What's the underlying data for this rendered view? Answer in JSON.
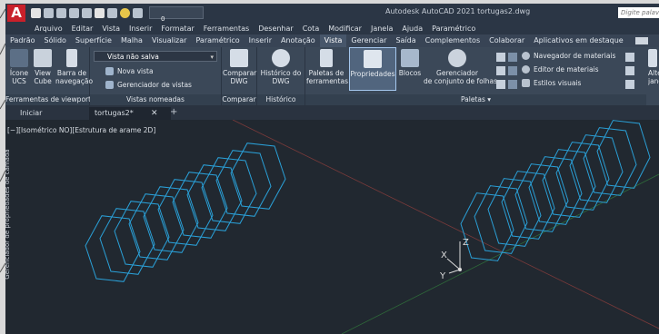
{
  "title_bar": {
    "logo": "A",
    "workspace_value": "0",
    "app_title": "Autodesk AutoCAD 2021   tortugas2.dwg",
    "search_placeholder": "Digite palavra-"
  },
  "menu": [
    "Arquivo",
    "Editar",
    "Vista",
    "Inserir",
    "Formatar",
    "Ferramentas",
    "Desenhar",
    "Cota",
    "Modificar",
    "Janela",
    "Ajuda",
    "Paramétrico"
  ],
  "ribbon_tabs": [
    {
      "label": "Padrão",
      "active": false
    },
    {
      "label": "Sólido",
      "active": false
    },
    {
      "label": "Superfície",
      "active": false
    },
    {
      "label": "Malha",
      "active": false
    },
    {
      "label": "Visualizar",
      "active": false
    },
    {
      "label": "Paramétrico",
      "active": false
    },
    {
      "label": "Inserir",
      "active": false
    },
    {
      "label": "Anotação",
      "active": false
    },
    {
      "label": "Vista",
      "active": true
    },
    {
      "label": "Gerenciar",
      "active": false
    },
    {
      "label": "Saída",
      "active": false
    },
    {
      "label": "Complementos",
      "active": false
    },
    {
      "label": "Colaborar",
      "active": false
    },
    {
      "label": "Aplicativos em destaque",
      "active": false
    }
  ],
  "panels": {
    "viewport_tools": {
      "title": "Ferramentas de viewport",
      "ucs_icon_l1": "Ícone",
      "ucs_icon_l2": "UCS",
      "viewcube_l1": "View",
      "viewcube_l2": "Cube",
      "navbar_l1": "Barra de",
      "navbar_l2": "navegação"
    },
    "named_views": {
      "title": "Vistas nomeadas",
      "view_select": "Vista não salva",
      "new_view": "Nova vista",
      "view_manager": "Gerenciador de vistas"
    },
    "compare": {
      "title": "Comparar",
      "btn_l1": "Comparar",
      "btn_l2": "DWG"
    },
    "history": {
      "title": "Histórico",
      "btn_l1": "Histórico do",
      "btn_l2": "DWG"
    },
    "palettes": {
      "title": "Paletas",
      "tool_palettes_l1": "Paletas de",
      "tool_palettes_l2": "ferramentas",
      "properties": "Propriedades",
      "blocks": "Blocos",
      "sheetset_l1": "Gerenciador",
      "sheetset_l2": "de conjunto de folhas",
      "materials_browser": "Navegador de materiais",
      "materials_editor": "Editor de materiais",
      "visual_styles": "Estilos visuais",
      "alt_l1": "Alter",
      "alt_l2": "jane"
    }
  },
  "doc_tabs": [
    {
      "label": "Iniciar"
    },
    {
      "label": "tortugas2*"
    }
  ],
  "viewport": {
    "label": "[−][Isométrico NO][Estrutura de arame 2D]",
    "side_palette": "Gerenciador de propriedades de camada",
    "axis_x": "X",
    "axis_y": "Y",
    "axis_z": "Z"
  },
  "colors": {
    "wireframe": "#2a9fd6",
    "axis_red": "#b24a4a",
    "axis_green": "#3d8a4a",
    "ribbon_bg": "#3b4858",
    "logo_red": "#c8202a"
  }
}
